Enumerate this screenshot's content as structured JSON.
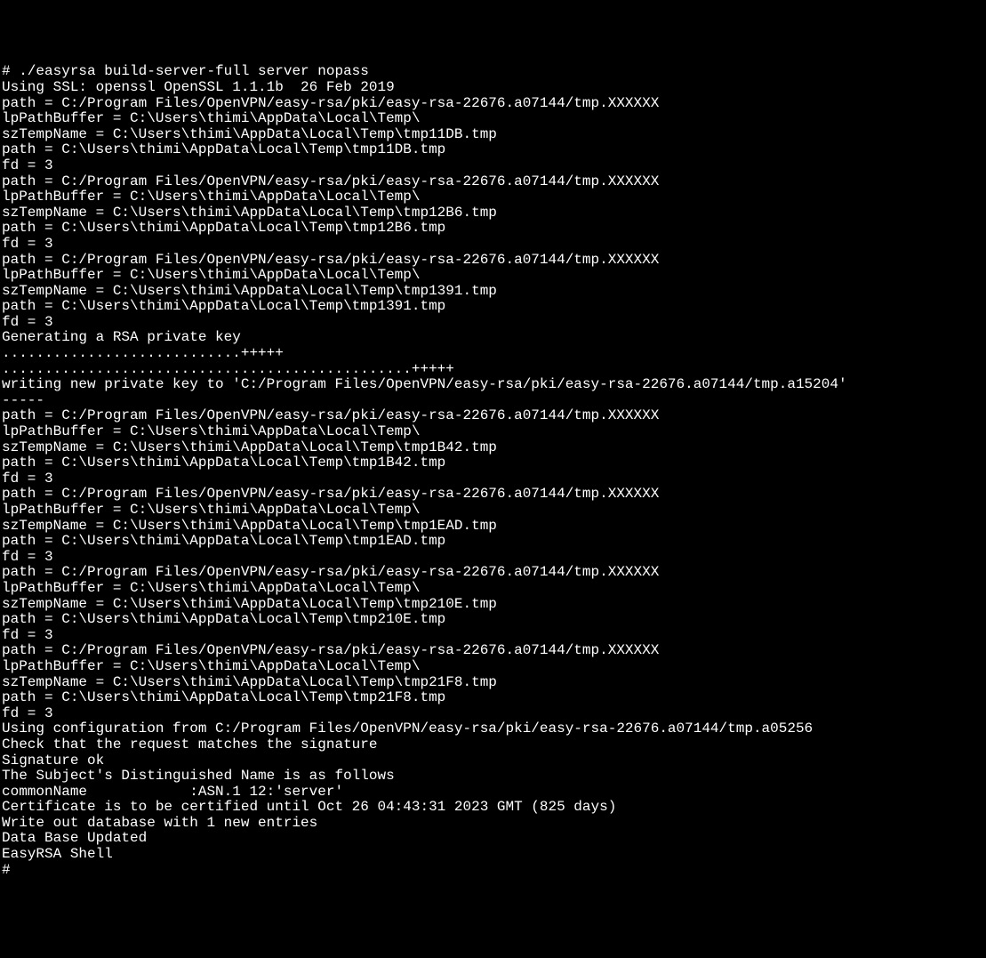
{
  "lines": [
    "# ./easyrsa build-server-full server nopass",
    "Using SSL: openssl OpenSSL 1.1.1b  26 Feb 2019",
    "path = C:/Program Files/OpenVPN/easy-rsa/pki/easy-rsa-22676.a07144/tmp.XXXXXX",
    "lpPathBuffer = C:\\Users\\thimi\\AppData\\Local\\Temp\\",
    "szTempName = C:\\Users\\thimi\\AppData\\Local\\Temp\\tmp11DB.tmp",
    "path = C:\\Users\\thimi\\AppData\\Local\\Temp\\tmp11DB.tmp",
    "fd = 3",
    "path = C:/Program Files/OpenVPN/easy-rsa/pki/easy-rsa-22676.a07144/tmp.XXXXXX",
    "lpPathBuffer = C:\\Users\\thimi\\AppData\\Local\\Temp\\",
    "szTempName = C:\\Users\\thimi\\AppData\\Local\\Temp\\tmp12B6.tmp",
    "path = C:\\Users\\thimi\\AppData\\Local\\Temp\\tmp12B6.tmp",
    "fd = 3",
    "path = C:/Program Files/OpenVPN/easy-rsa/pki/easy-rsa-22676.a07144/tmp.XXXXXX",
    "lpPathBuffer = C:\\Users\\thimi\\AppData\\Local\\Temp\\",
    "szTempName = C:\\Users\\thimi\\AppData\\Local\\Temp\\tmp1391.tmp",
    "path = C:\\Users\\thimi\\AppData\\Local\\Temp\\tmp1391.tmp",
    "fd = 3",
    "Generating a RSA private key",
    "............................+++++",
    "................................................+++++",
    "writing new private key to 'C:/Program Files/OpenVPN/easy-rsa/pki/easy-rsa-22676.a07144/tmp.a15204'",
    "-----",
    "path = C:/Program Files/OpenVPN/easy-rsa/pki/easy-rsa-22676.a07144/tmp.XXXXXX",
    "lpPathBuffer = C:\\Users\\thimi\\AppData\\Local\\Temp\\",
    "szTempName = C:\\Users\\thimi\\AppData\\Local\\Temp\\tmp1B42.tmp",
    "path = C:\\Users\\thimi\\AppData\\Local\\Temp\\tmp1B42.tmp",
    "fd = 3",
    "path = C:/Program Files/OpenVPN/easy-rsa/pki/easy-rsa-22676.a07144/tmp.XXXXXX",
    "lpPathBuffer = C:\\Users\\thimi\\AppData\\Local\\Temp\\",
    "szTempName = C:\\Users\\thimi\\AppData\\Local\\Temp\\tmp1EAD.tmp",
    "path = C:\\Users\\thimi\\AppData\\Local\\Temp\\tmp1EAD.tmp",
    "fd = 3",
    "path = C:/Program Files/OpenVPN/easy-rsa/pki/easy-rsa-22676.a07144/tmp.XXXXXX",
    "lpPathBuffer = C:\\Users\\thimi\\AppData\\Local\\Temp\\",
    "szTempName = C:\\Users\\thimi\\AppData\\Local\\Temp\\tmp210E.tmp",
    "path = C:\\Users\\thimi\\AppData\\Local\\Temp\\tmp210E.tmp",
    "fd = 3",
    "path = C:/Program Files/OpenVPN/easy-rsa/pki/easy-rsa-22676.a07144/tmp.XXXXXX",
    "lpPathBuffer = C:\\Users\\thimi\\AppData\\Local\\Temp\\",
    "szTempName = C:\\Users\\thimi\\AppData\\Local\\Temp\\tmp21F8.tmp",
    "path = C:\\Users\\thimi\\AppData\\Local\\Temp\\tmp21F8.tmp",
    "fd = 3",
    "Using configuration from C:/Program Files/OpenVPN/easy-rsa/pki/easy-rsa-22676.a07144/tmp.a05256",
    "Check that the request matches the signature",
    "Signature ok",
    "The Subject's Distinguished Name is as follows",
    "commonName            :ASN.1 12:'server'",
    "Certificate is to be certified until Oct 26 04:43:31 2023 GMT (825 days)",
    "",
    "Write out database with 1 new entries",
    "Data Base Updated",
    "",
    "",
    "EasyRSA Shell",
    "# "
  ]
}
